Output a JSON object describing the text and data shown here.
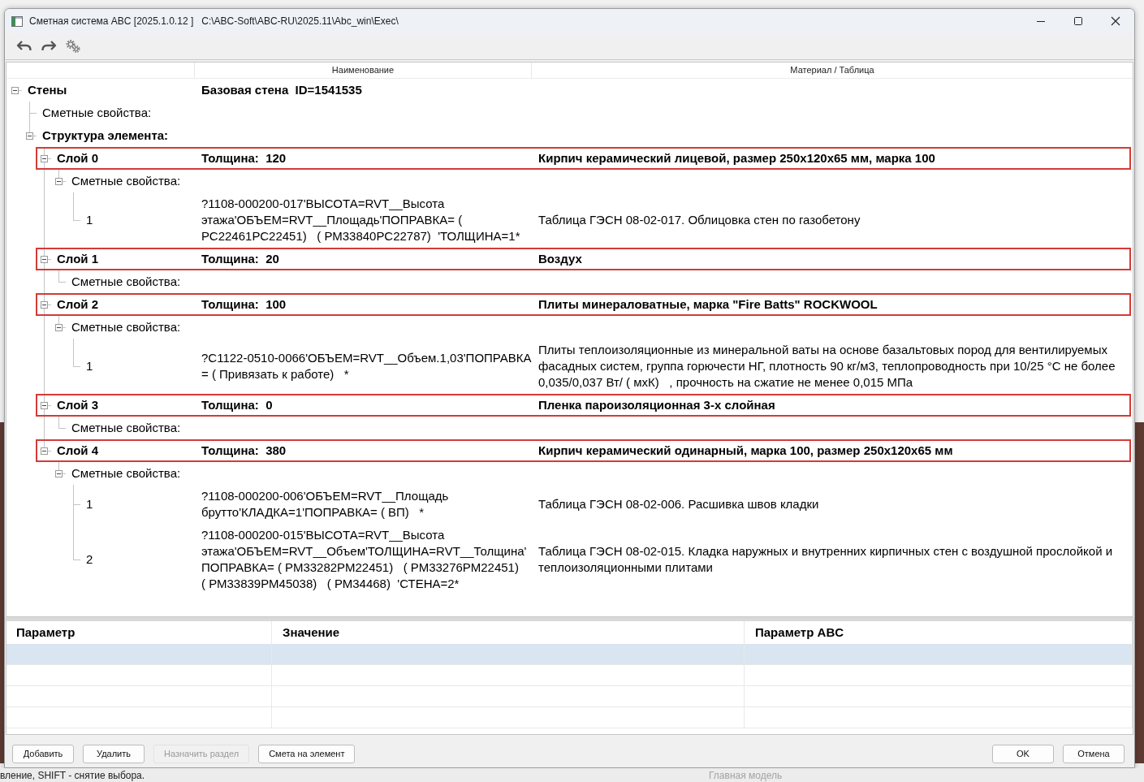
{
  "window": {
    "title": "Сметная система ABC [2025.1.0.12 ]",
    "path": "C:\\ABC-Soft\\ABC-RU\\2025.11\\Abc_win\\Exec\\"
  },
  "tree": {
    "columns": [
      "Наименование",
      "Материал / Таблица"
    ],
    "nodes": [
      {
        "kind": "element",
        "label": "Стены",
        "name": "Базовая стена  ID=1541535",
        "expanded": true,
        "children": [
          {
            "kind": "properties",
            "label": "Сметные свойства:"
          },
          {
            "kind": "structure",
            "label": "Структура элемента:",
            "expanded": true,
            "children": [
              {
                "kind": "layer",
                "label": "Слой 0",
                "name": "Толщина:  120",
                "material": "Кирпич керамический лицевой, размер 250x120x65 мм, марка 100",
                "highlighted": true,
                "expanded": true,
                "children": [
                  {
                    "kind": "properties",
                    "label": "Сметные свойства:",
                    "expanded": true,
                    "children": [
                      {
                        "kind": "entry",
                        "label": "1",
                        "name": "?1108-000200-017'ВЫСОТА=RVT__Высота этажа'ОБЪЕМ=RVT__Площадь'ПОПРАВКА= ( РС22461РС22451)   ( РМ33840РС22787)  'ТОЛЩИНА=1*",
                        "material": "Таблица ГЭСН 08-02-017. Облицовка стен по газобетону"
                      }
                    ]
                  }
                ]
              },
              {
                "kind": "layer",
                "label": "Слой 1",
                "name": "Толщина:  20",
                "material": "Воздух",
                "highlighted": true,
                "expanded": true,
                "children": [
                  {
                    "kind": "properties",
                    "label": "Сметные свойства:"
                  }
                ]
              },
              {
                "kind": "layer",
                "label": "Слой 2",
                "name": "Толщина:  100",
                "material": "Плиты минераловатные, марка \"Fire Batts\" ROCKWOOL",
                "highlighted": true,
                "expanded": true,
                "children": [
                  {
                    "kind": "properties",
                    "label": "Сметные свойства:",
                    "expanded": true,
                    "children": [
                      {
                        "kind": "entry",
                        "label": "1",
                        "name": "?С1122-0510-0066'ОБЪЕМ=RVT__Объем.1,03'ПОПРАВКА = ( Привязать к работе)   *",
                        "material": "Плиты теплоизоляционные из минеральной ваты на основе базальтовых пород для вентилируемых фасадных систем, группа горючести НГ, плотность 90 кг/м3, теплопроводность при 10/25 °С не более 0,035/0,037 Вт/ ( мхК)   , прочность на сжатие не менее 0,015 МПа"
                      }
                    ]
                  }
                ]
              },
              {
                "kind": "layer",
                "label": "Слой 3",
                "name": "Толщина:  0",
                "material": "Пленка пароизоляционная 3-х слойная",
                "highlighted": true,
                "expanded": true,
                "children": [
                  {
                    "kind": "properties",
                    "label": "Сметные свойства:"
                  }
                ]
              },
              {
                "kind": "layer",
                "label": "Слой 4",
                "name": "Толщина:  380",
                "material": "Кирпич керамический одинарный, марка 100, размер 250x120x65 мм",
                "highlighted": true,
                "expanded": true,
                "children": [
                  {
                    "kind": "properties",
                    "label": "Сметные свойства:",
                    "expanded": true,
                    "children": [
                      {
                        "kind": "entry",
                        "label": "1",
                        "name": "?1108-000200-006'ОБЪЕМ=RVT__Площадь брутто'КЛАДКА=1'ПОПРАВКА= ( ВП)   *",
                        "material": "Таблица ГЭСН 08-02-006. Расшивка швов кладки"
                      },
                      {
                        "kind": "entry",
                        "label": "2",
                        "name": "?1108-000200-015'ВЫСОТА=RVT__Высота этажа'ОБЪЕМ=RVT__Объем'ТОЛЩИНА=RVT__Толщина'ПОПРАВКА= ( РМ33282РМ22451)   ( РМ33276РМ22451)   ( РМ33839РМ45038)   ( РМ34468)  'СТЕНА=2*",
                        "material": "Таблица ГЭСН 08-02-015. Кладка наружных и внутренних кирпичных стен с воздушной прослойкой и теплоизоляционными плитами"
                      }
                    ]
                  }
                ]
              }
            ]
          }
        ]
      }
    ]
  },
  "params_table": {
    "columns": [
      "Параметр",
      "Значение",
      "Параметр ABC"
    ],
    "rows": [
      {
        "selected": true
      },
      {
        "selected": false
      },
      {
        "selected": false
      },
      {
        "selected": false
      }
    ]
  },
  "buttons": [
    {
      "label": "Добавить",
      "disabled": false
    },
    {
      "label": "Удалить",
      "disabled": false
    },
    {
      "label": "Назначить раздел",
      "disabled": true
    },
    {
      "label": "Смета на элемент",
      "disabled": false
    }
  ],
  "dialog_buttons": [
    {
      "label": "OK"
    },
    {
      "label": "Отмена"
    }
  ],
  "status_bar": {
    "hint": "вление, SHIFT - снятие выбора.",
    "model": "Главная модель"
  }
}
